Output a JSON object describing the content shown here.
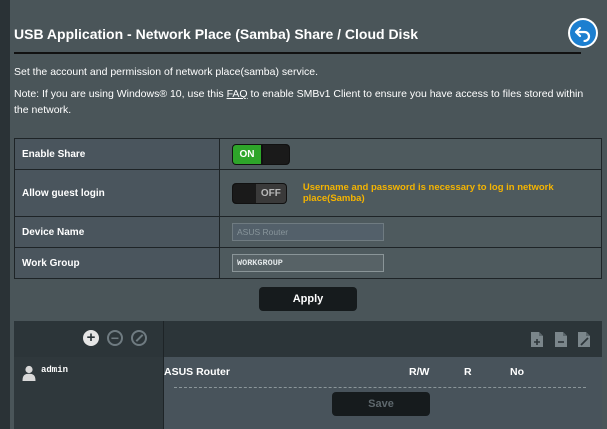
{
  "page": {
    "title": "USB Application - Network Place (Samba) Share / Cloud Disk",
    "description": "Set the account and permission of network place(samba) service.",
    "note_prefix": "Note: If you are using Windows® 10, use this ",
    "note_link": "FAQ",
    "note_suffix": " to enable SMBv1 Client to ensure you have access to files stored within the network."
  },
  "settings": {
    "enable_share": {
      "label": "Enable Share",
      "state": "ON"
    },
    "guest_login": {
      "label": "Allow guest login",
      "state": "OFF",
      "hint": "Username and password is necessary to log in network place(Samba)"
    },
    "device_name": {
      "label": "Device Name",
      "value": "ASUS Router"
    },
    "work_group": {
      "label": "Work Group",
      "value": "WORKGROUP"
    }
  },
  "buttons": {
    "apply": "Apply",
    "save": "Save"
  },
  "accounts": {
    "user": "admin",
    "share_name": "ASUS Router",
    "perm_rw": "R/W",
    "perm_r": "R",
    "perm_no": "No"
  },
  "colors": {
    "toggle_on": "#2ea52a",
    "hint": "#f5b400",
    "accent_blue": "#1c7fd0"
  }
}
